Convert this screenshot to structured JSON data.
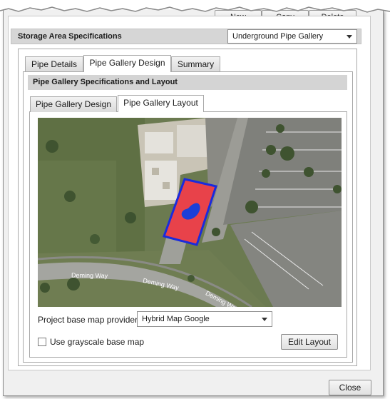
{
  "toolbar": {
    "new_label": "New",
    "copy_label": "Copy",
    "delete_label": "Delete"
  },
  "storage": {
    "title": "Storage Area Specifications",
    "type_value": "Underground Pipe Gallery"
  },
  "tabs": [
    {
      "label": "Pipe Details",
      "active": false
    },
    {
      "label": "Pipe Gallery Design",
      "active": true
    },
    {
      "label": "Summary",
      "active": false
    }
  ],
  "section": {
    "title": "Pipe Gallery Specifications and Layout"
  },
  "subtabs": [
    {
      "label": "Pipe Gallery Design",
      "active": false
    },
    {
      "label": "Pipe Gallery Layout",
      "active": true
    }
  ],
  "map": {
    "street_labels": [
      "Deming Way",
      "Deming Way",
      "Deming Way"
    ],
    "footprint_fill": "#e8424a",
    "footprint_stroke": "#1a2bdc",
    "pipe_fill": "#1a3fd8"
  },
  "provider": {
    "label": "Project base map provider:",
    "value": "Hybrid Map Google"
  },
  "grayscale": {
    "label": "Use grayscale base map",
    "checked": false
  },
  "edit_layout_label": "Edit Layout",
  "close_label": "Close",
  "icons": {
    "dropdown": "chevron-down-icon",
    "checkbox": "checkbox-icon"
  }
}
